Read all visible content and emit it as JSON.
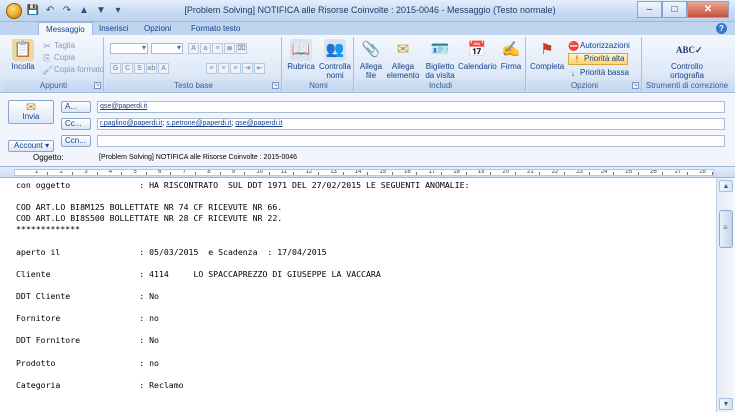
{
  "window": {
    "title": "[Problem Solving]  NOTIFICA alle Risorse Coinvolte : 2015-0046 - Messaggio (Testo normale)",
    "minimize": "–",
    "maximize": "□",
    "close": "✕"
  },
  "qat": {
    "save": "💾",
    "undo": "↶",
    "redo": "↷",
    "up": "▲",
    "down": "▼",
    "more": "▾"
  },
  "tabs": [
    "Messaggio",
    "Inserisci",
    "Opzioni",
    "Formato testo"
  ],
  "help": "?",
  "ribbon": {
    "appunti": {
      "label": "Appunti",
      "paste": "Incolla",
      "cut": "Taglia",
      "copy": "Copia",
      "format_painter": "Copia formato"
    },
    "testo_base": {
      "label": "Testo base",
      "bold": "G",
      "italic": "C",
      "underline": "S"
    },
    "nomi": {
      "label": "Nomi",
      "rubrica": "Rubrica",
      "controlla": "Controlla",
      "controlla2": "nomi"
    },
    "includi": {
      "label": "Includi",
      "allega_file": "Allega",
      "allega_file2": "file",
      "allega_elemento": "Allega",
      "allega_elemento2": "elemento",
      "biglietto": "Biglietto",
      "biglietto2": "da visita",
      "calendario": "Calendario",
      "firma": "Firma"
    },
    "opzioni": {
      "label": "Opzioni",
      "completa": "Completa",
      "autorizzazioni": "Autorizzazioni",
      "priorita_alta": "Priorità alta",
      "priorita_bassa": "Priorità bassa"
    },
    "strumenti": {
      "label": "Strumenti di correzione",
      "controllo": "Controllo",
      "ortografia": "ortografia"
    }
  },
  "header": {
    "send": "Invia",
    "to_btn": "A...",
    "cc_btn": "Cc...",
    "ccn_btn": "Ccn...",
    "account_btn": "Account",
    "to": [
      "qse@paperdi.it"
    ],
    "cc": [
      "r.paglino@paperdi.it",
      "s.petrone@paperdi.it",
      "qse@paperdi.it"
    ],
    "ccn": "",
    "subject_label": "Oggetto:",
    "subject": "[Problem Solving]   NOTIFICA alle Risorse Coinvolte  :  2015-0046"
  },
  "ruler": {
    "numbers": [
      "1",
      "2",
      "3",
      "4",
      "5",
      "6",
      "7",
      "8",
      "9",
      "10",
      "11",
      "12",
      "13",
      "14",
      "15",
      "16",
      "17",
      "18",
      "19",
      "20",
      "21",
      "22",
      "23",
      "24",
      "25",
      "26",
      "27",
      "28"
    ]
  },
  "body_lines": [
    "con oggetto              : HA RISCONTRATO  SUL DDT 1971 DEL 27/02/2015 LE SEGUENTI ANOMALIE:",
    "",
    "COD ART.LO BI8M125 BOLLETTATE NR 74 CF RICEVUTE NR 66.",
    "COD ART.LO BI8S500 BOLLETTATE NR 28 CF RICEVUTE NR 22.",
    "*************",
    "",
    "aperto il                : 05/03/2015  e Scadenza  : 17/04/2015",
    "",
    "Cliente                  : 4114     LO SPACCAPREZZO DI GIUSEPPE LA VACCARA",
    "",
    "DDT Cliente              : No",
    "",
    "Fornitore                : no",
    "",
    "DDT Fornitore            : No",
    "",
    "Prodotto                 : no",
    "",
    "Categoria                : Reclamo"
  ],
  "scrollbar": {
    "up": "▲",
    "down": "▼"
  }
}
